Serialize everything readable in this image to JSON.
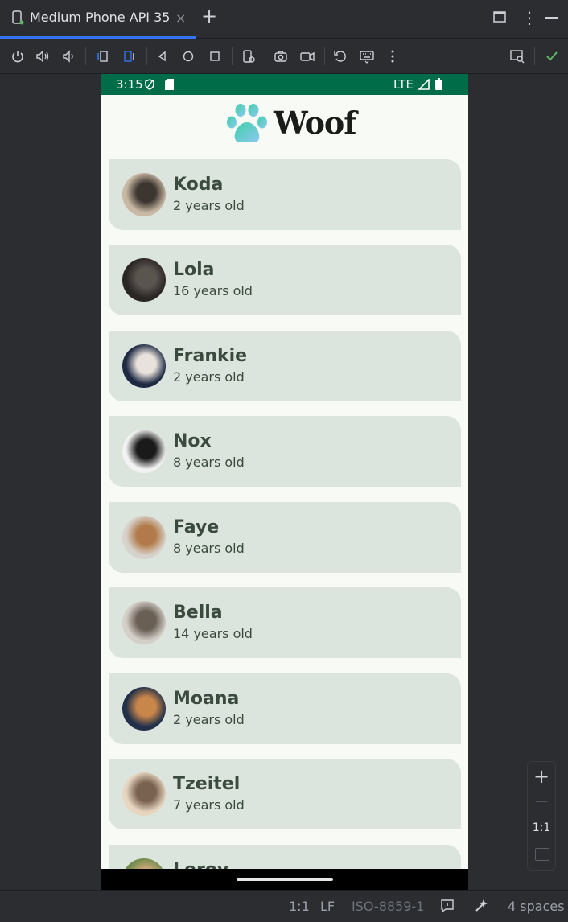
{
  "tab": {
    "title": "Medium Phone API 35",
    "close_glyph": "×",
    "add_glyph": "+"
  },
  "window": {
    "more_glyph": "⋮"
  },
  "toolbar": {
    "icons": [
      "power-icon",
      "volume-up-icon",
      "volume-down-icon",
      "rotate-left-icon",
      "rotate-right-icon",
      "back-icon",
      "home-icon",
      "overview-icon",
      "device-settings-icon",
      "screenshot-icon",
      "screen-record-icon",
      "reset-icon",
      "keyboard-icon",
      "more-icon",
      "layout-inspector-icon",
      "check-icon"
    ]
  },
  "device": {
    "status_time": "3:15",
    "status_network": "LTE",
    "app_title": "Woof",
    "colors": {
      "status_bar": "#006c48",
      "card": "#dce5dd",
      "background": "#f7faf5"
    },
    "dogs": [
      {
        "name": "Koda",
        "age": "2 years old"
      },
      {
        "name": "Lola",
        "age": "16 years old"
      },
      {
        "name": "Frankie",
        "age": "2 years old"
      },
      {
        "name": "Nox",
        "age": "8 years old"
      },
      {
        "name": "Faye",
        "age": "8 years old"
      },
      {
        "name": "Bella",
        "age": "14 years old"
      },
      {
        "name": "Moana",
        "age": "2 years old"
      },
      {
        "name": "Tzeitel",
        "age": "7 years old"
      },
      {
        "name": "Leroy",
        "age": ""
      }
    ]
  },
  "zoom": {
    "plus": "+",
    "ratio": "1:1"
  },
  "statusbar": {
    "position": "1:1",
    "line_ending": "LF",
    "encoding": "ISO-8859-1",
    "indent": "4 spaces"
  }
}
